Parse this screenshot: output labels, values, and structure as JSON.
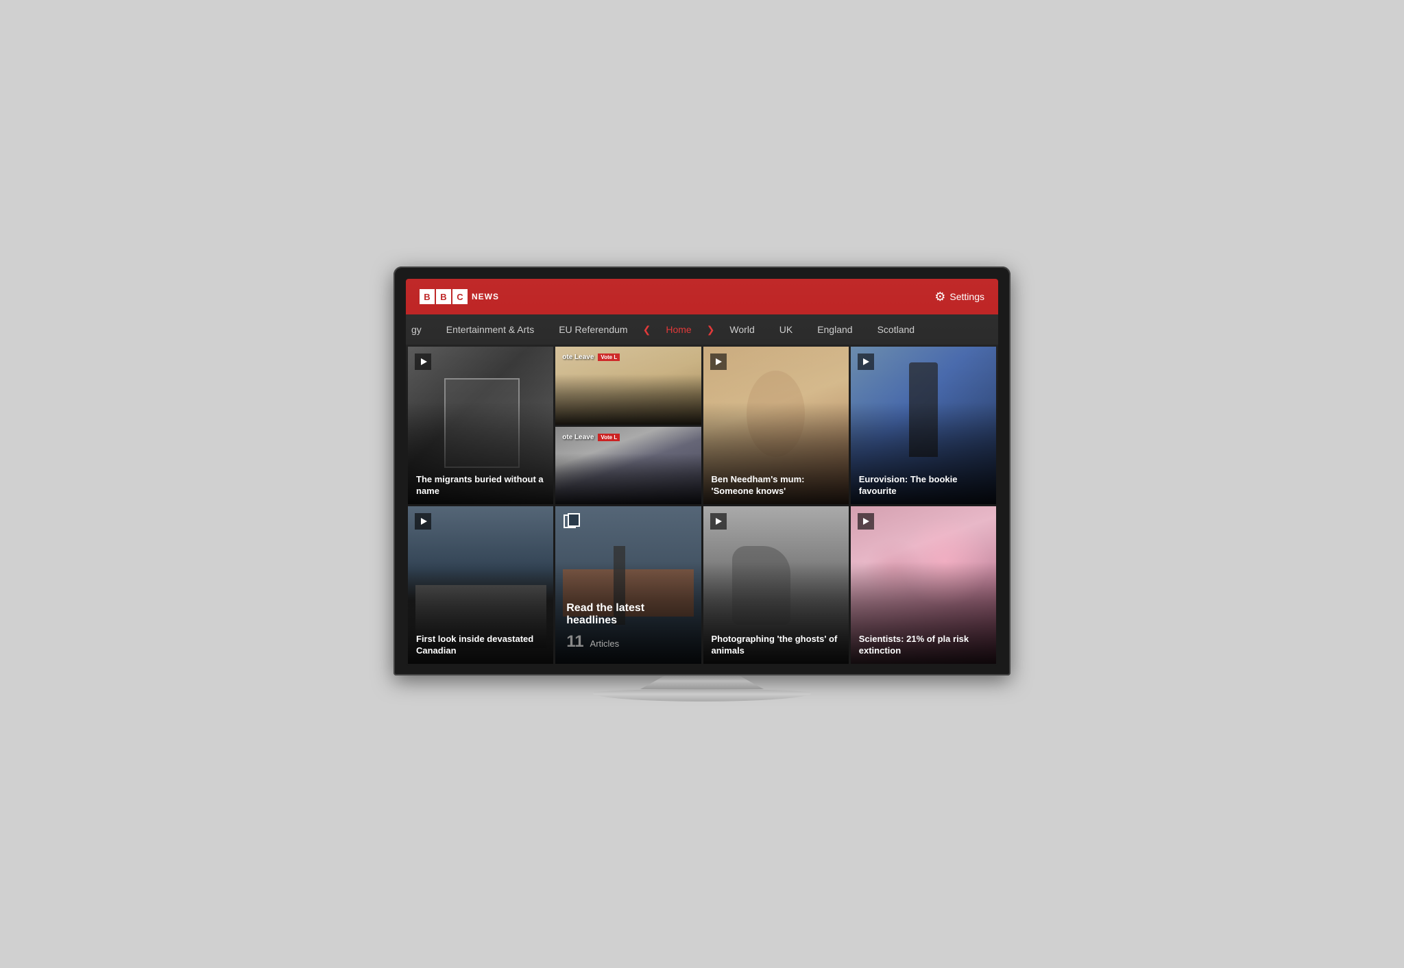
{
  "header": {
    "bbc_b": "B",
    "bbc_b2": "B",
    "bbc_c": "C",
    "news_label": "NEWS",
    "settings_label": "Settings"
  },
  "nav": {
    "partial_left": "gy",
    "items": [
      {
        "label": "Entertainment & Arts",
        "active": false
      },
      {
        "label": "EU Referendum",
        "active": false
      },
      {
        "label": "Home",
        "active": true
      },
      {
        "label": "World",
        "active": false
      },
      {
        "label": "UK",
        "active": false
      },
      {
        "label": "England",
        "active": false
      },
      {
        "label": "Scotland",
        "active": false
      }
    ]
  },
  "cards": {
    "row1": [
      {
        "title": "The migrants buried without a name",
        "has_play": true,
        "image_type": "migrants"
      },
      {
        "type": "eu_split",
        "sub_cards": [
          {
            "image_type": "writing",
            "vote_leave": "ote Leave",
            "vote_l": "Vote L"
          },
          {
            "image_type": "iain_ds",
            "vote_leave2": "ote Leave",
            "vote_l2": "Vote L"
          }
        ]
      },
      {
        "title": "Ben Needham's mum: 'Someone knows'",
        "has_play": true,
        "image_type": "ben_needham"
      },
      {
        "title": "Eurovision: The bookie favourite",
        "has_play": true,
        "image_type": "eurovision"
      }
    ],
    "row2": [
      {
        "title": "First look inside devastated Canadian",
        "has_play": true,
        "image_type": "canada"
      },
      {
        "type": "headlines",
        "title": "Read the latest headlines",
        "count": "11",
        "count_label": "Articles"
      },
      {
        "title": "Photographing 'the ghosts' of animals",
        "has_play": true,
        "image_type": "ghosts"
      },
      {
        "title": "Scientists: 21% of pla risk extinction",
        "has_play": true,
        "image_type": "plants"
      }
    ]
  }
}
